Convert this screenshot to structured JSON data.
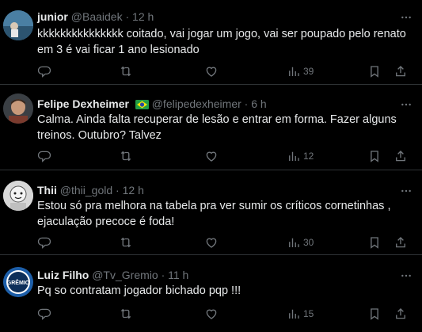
{
  "tweets": [
    {
      "name": "junior",
      "handle": "@Baaidek",
      "dot": "·",
      "time": "12 h",
      "text": "kkkkkkkkkkkkkkk coitado, vai jogar um jogo, vai ser poupado pelo renato em 3 é vai ficar 1 ano lesionado",
      "views": "39"
    },
    {
      "name": "Felipe Dexheimer",
      "handle": "@felipedexheimer",
      "dot": "·",
      "time": "6 h",
      "text": "Calma. Ainda falta recuperar de lesão e entrar em forma. Fazer alguns treinos. Outubro? Talvez",
      "views": "12"
    },
    {
      "name": "Thii",
      "handle": "@thii_gold",
      "dot": "·",
      "time": "12 h",
      "text": "Estou só pra melhora na tabela pra ver sumir os críticos  cornetinhas , ejaculação precoce é foda!",
      "views": "30"
    },
    {
      "name": "Luiz Filho",
      "handle": "@Tv_Gremio",
      "dot": "·",
      "time": "11 h",
      "text": "Pq so contratam jogador bichado pqp !!!",
      "views": "15",
      "avatar_text": "GRÊMIO"
    }
  ],
  "colors": {
    "background": "#000000",
    "text": "#e7e9ea",
    "muted": "#71767b",
    "border": "#2f3336"
  },
  "icons": [
    "more-icon",
    "reply-icon",
    "retweet-icon",
    "like-icon",
    "views-icon",
    "bookmark-icon",
    "share-icon",
    "brazil-flag-icon"
  ]
}
